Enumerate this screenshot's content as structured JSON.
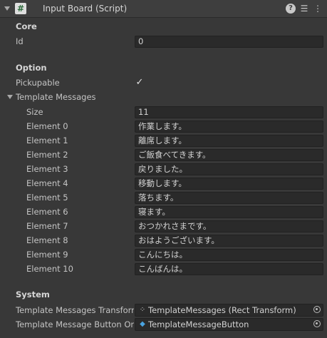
{
  "header": {
    "title": "Input Board (Script)",
    "script_icon": "#",
    "help_icon": "?",
    "settings_icon": "☰",
    "menu_icon": "⋮"
  },
  "core": {
    "section": "Core",
    "id_label": "Id",
    "id_value": "0"
  },
  "option": {
    "section": "Option",
    "pickupable_label": "Pickupable",
    "pickupable_checked": "✓",
    "template_messages_label": "Template Messages",
    "size_label": "Size",
    "size_value": "11",
    "elements": [
      {
        "label": "Element 0",
        "value": "作業します。"
      },
      {
        "label": "Element 1",
        "value": "離席します。"
      },
      {
        "label": "Element 2",
        "value": "ご飯食べてきます。"
      },
      {
        "label": "Element 3",
        "value": "戻りました。"
      },
      {
        "label": "Element 4",
        "value": "移動します。"
      },
      {
        "label": "Element 5",
        "value": "落ちます。"
      },
      {
        "label": "Element 6",
        "value": "寝ます。"
      },
      {
        "label": "Element 7",
        "value": "おつかれさまです。"
      },
      {
        "label": "Element 8",
        "value": "おはようございます。"
      },
      {
        "label": "Element 9",
        "value": "こんにちは。"
      },
      {
        "label": "Element 10",
        "value": "こんばんは。"
      }
    ]
  },
  "system": {
    "section": "System",
    "transform_label": "Template Messages Transform",
    "transform_value": "TemplateMessages (Rect Transform)",
    "transform_icon": "⁘",
    "button_label": "Template Message Button Original",
    "button_value": "TemplateMessageButton",
    "button_icon": "◆"
  },
  "colors": {
    "background": "#383838",
    "field": "#2a2a2a",
    "prefab_icon": "#4aa3e0"
  }
}
